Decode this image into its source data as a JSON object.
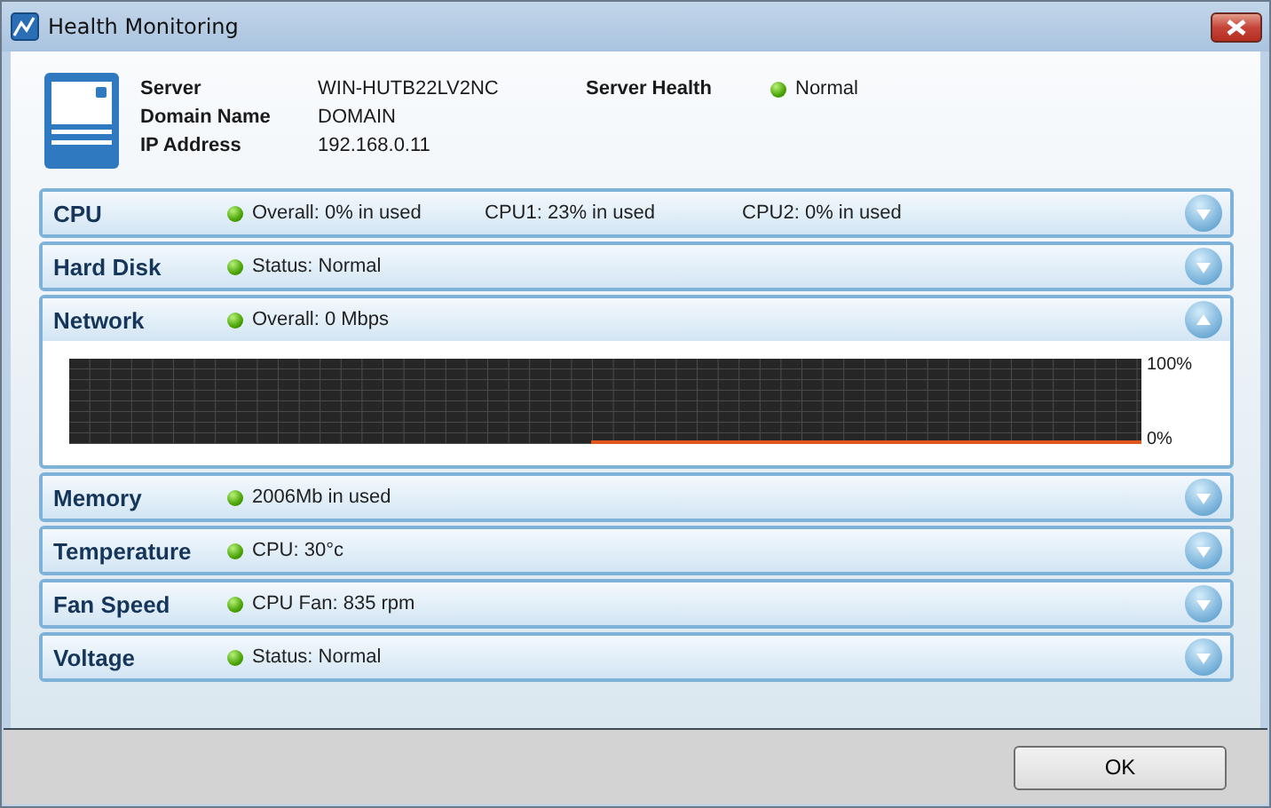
{
  "window": {
    "title": "Health Monitoring"
  },
  "server": {
    "fields": [
      {
        "label": "Server",
        "value": "WIN-HUTB22LV2NC"
      },
      {
        "label": "Domain Name",
        "value": "DOMAIN"
      },
      {
        "label": "IP Address",
        "value": "192.168.0.11"
      }
    ],
    "health_label": "Server Health",
    "health_value": "Normal"
  },
  "sections": [
    {
      "title": "CPU",
      "expanded": false,
      "details": [
        "Overall: 0% in used",
        "CPU1: 23% in used",
        "CPU2: 0% in used"
      ]
    },
    {
      "title": "Hard Disk",
      "expanded": false,
      "details": [
        "Status: Normal"
      ]
    },
    {
      "title": "Network",
      "expanded": true,
      "details": [
        "Overall: 0 Mbps"
      ],
      "graph": {
        "max_label": "100%",
        "min_label": "0%"
      }
    },
    {
      "title": "Memory",
      "expanded": false,
      "details": [
        "2006Mb in used"
      ]
    },
    {
      "title": "Temperature",
      "expanded": false,
      "details": [
        "CPU: 30°c"
      ]
    },
    {
      "title": "Fan Speed",
      "expanded": false,
      "details": [
        "CPU Fan: 835 rpm"
      ]
    },
    {
      "title": "Voltage",
      "expanded": false,
      "details": [
        "Status: Normal"
      ]
    }
  ],
  "buttons": [
    "OK"
  ]
}
